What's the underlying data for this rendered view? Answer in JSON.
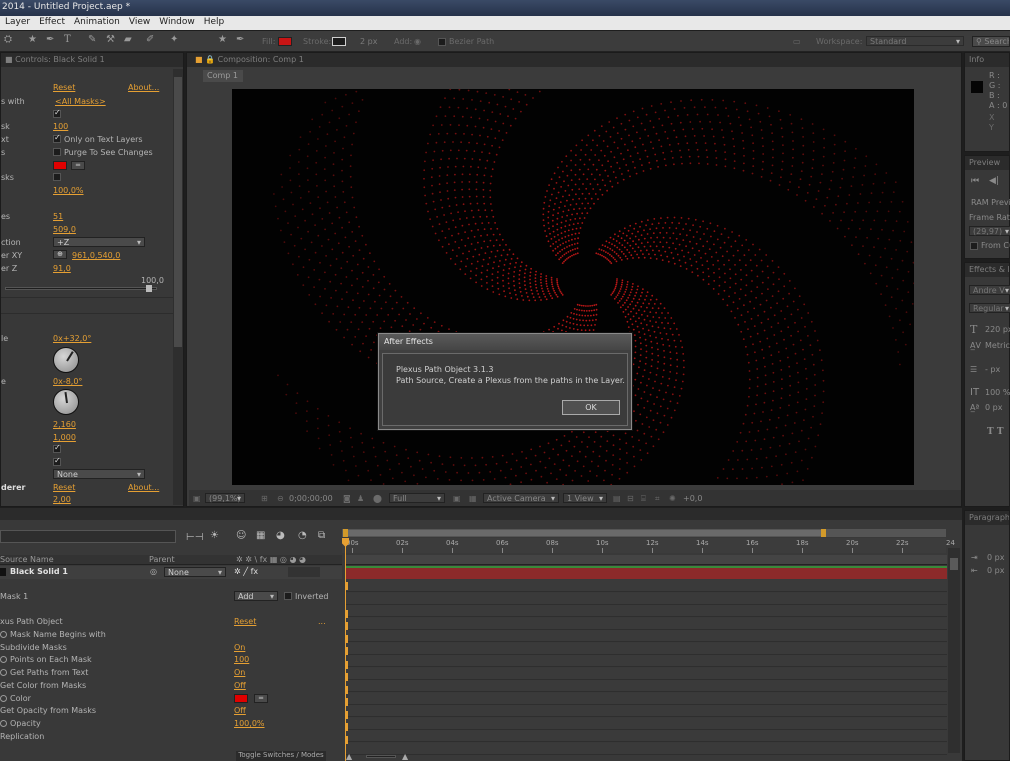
{
  "window": {
    "title": "2014 - Untitled Project.aep *"
  },
  "menu": [
    "Layer",
    "Effect",
    "Animation",
    "View",
    "Window",
    "Help"
  ],
  "toolbar": {
    "fill_label": "Fill:",
    "fill_color": "#c81414",
    "stroke_label": "Stroke:",
    "stroke_width": "2 px",
    "add_label": "Add:",
    "bezier_label": "Bezier Path",
    "workspace_label": "Workspace:",
    "workspace_value": "Standard",
    "search_label": "Search"
  },
  "effect_controls": {
    "tab": "Controls: Black Solid 1",
    "header": {
      "reset": "Reset",
      "about": "About..."
    },
    "rows": [
      {
        "label": "s with",
        "value": "<All Masks>"
      },
      {
        "label": "",
        "check": true
      },
      {
        "label": "sk",
        "value": "100"
      },
      {
        "label": "xt",
        "check": true,
        "check_label": "Only on Text Layers"
      },
      {
        "label": "s",
        "check": false,
        "check_label": "Purge To See Changes"
      },
      {
        "label": "",
        "color": "#e00000"
      },
      {
        "label": "sks",
        "check": false
      },
      {
        "label": "",
        "value": "100,0%"
      },
      {
        "label": "es",
        "value": "51"
      },
      {
        "label": "",
        "value": "509,0"
      },
      {
        "label": "ction",
        "dropdown": "+Z"
      },
      {
        "label": "er XY",
        "value": "961,0,540,0"
      },
      {
        "label": "er Z",
        "value": "91,0"
      },
      {
        "label": "",
        "slider_value": "100,0"
      },
      {
        "label": "le",
        "value": "0x+32,0°"
      },
      {
        "label": "e",
        "value": "0x-8,0°"
      },
      {
        "label": "",
        "value": "2,160"
      },
      {
        "label": "",
        "value": "1,000"
      },
      {
        "label": "",
        "check": true
      },
      {
        "label": "",
        "check": true
      },
      {
        "label": "",
        "dropdown": "None"
      },
      {
        "label": "derer",
        "reset": "Reset",
        "about": "About..."
      },
      {
        "label": "",
        "value": "2,00"
      }
    ]
  },
  "composition": {
    "tab": "Composition: Comp 1",
    "subtab": "Comp 1",
    "footer": {
      "zoom": "(99,1%)",
      "timecode": "0;00;00;00",
      "resolution": "Full",
      "camera": "Active Camera",
      "views": "1 View",
      "exposure": "+0,0"
    }
  },
  "dialog": {
    "title": "After Effects",
    "line1": "Plexus Path Object 3.1.3",
    "line2": "Path Source, Create a Plexus from the paths in the Layer.",
    "ok": "OK"
  },
  "info_panel": {
    "tab": "Info",
    "r": "R :",
    "g": "G :",
    "b": "B :",
    "a": "A : 0",
    "x": "X",
    "y": "Y"
  },
  "preview_panel": {
    "tab": "Preview",
    "ram": "RAM Previ",
    "frame_rate": "Frame Rate",
    "fps": "(29,97)",
    "from": "From Cu"
  },
  "effects_panel": {
    "tab": "Effects & P",
    "font": "Andre V",
    "style": "Regular",
    "size": "220 px",
    "metrics": "Metrics",
    "px": "- px",
    "scale": "100 %",
    "baseline": "0 px",
    "tt": "T  T"
  },
  "paragraph_panel": {
    "tab": "Paragraph",
    "p1": "0 px",
    "p2": "0 px"
  },
  "timeline": {
    "col_source": "Source Name",
    "col_parent": "Parent",
    "ruler": [
      "00s",
      "02s",
      "04s",
      "06s",
      "08s",
      "10s",
      "12s",
      "14s",
      "16s",
      "18s",
      "20s",
      "22s",
      "24"
    ],
    "layer": {
      "name": "Black Solid 1",
      "parent": "None"
    },
    "rows": [
      {
        "label": "Mask 1",
        "add": "Add",
        "inverted": "Inverted"
      },
      {
        "label": "xus Path Object",
        "value": "Reset",
        "extra": "..."
      },
      {
        "label": "Mask Name Begins with",
        "stop": true
      },
      {
        "label": "Subdivide Masks",
        "value": "On"
      },
      {
        "label": "Points on Each Mask",
        "stop": true,
        "value": "100"
      },
      {
        "label": "Get Paths from Text",
        "stop": true,
        "value": "On"
      },
      {
        "label": "Get Color from Masks",
        "value": "Off"
      },
      {
        "label": "Color",
        "stop": true,
        "color": "#e00000"
      },
      {
        "label": "Get Opacity from Masks",
        "value": "Off"
      },
      {
        "label": "Opacity",
        "stop": true,
        "value": "100,0%"
      },
      {
        "label": "Replication"
      }
    ],
    "toggle": "Toggle Switches / Modes"
  }
}
